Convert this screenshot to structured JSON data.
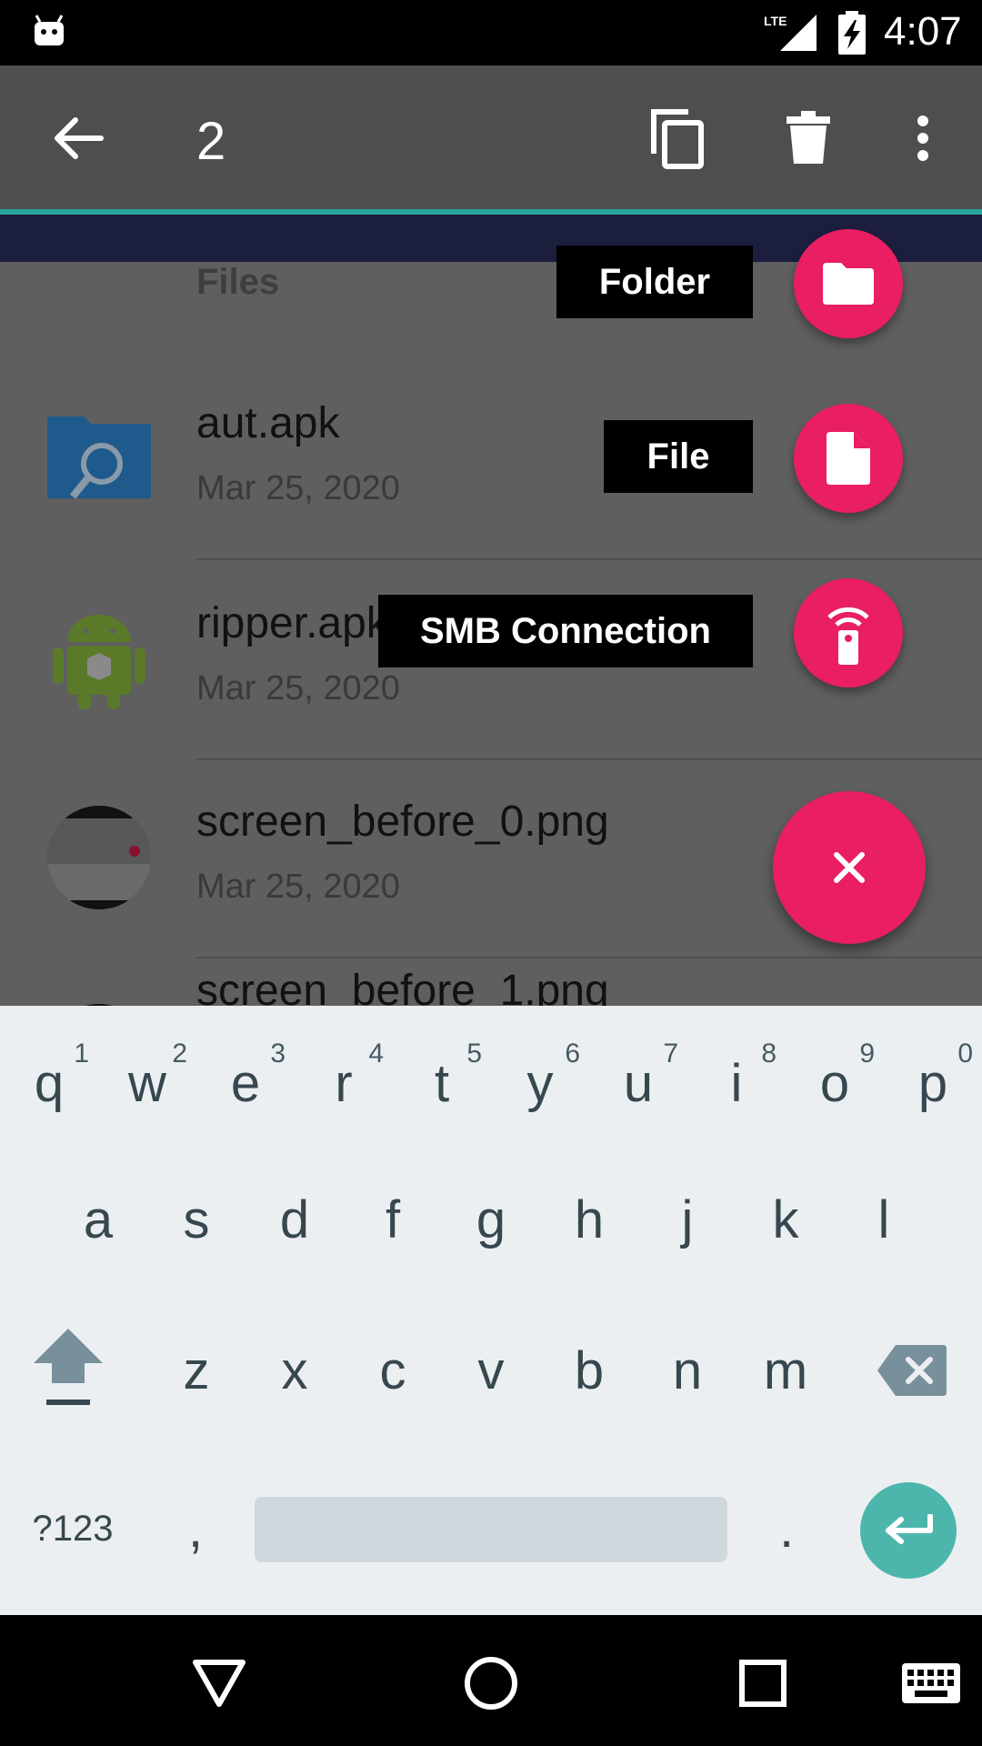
{
  "status_bar": {
    "network": "LTE",
    "time": "4:07",
    "icons": [
      "android-debug-icon",
      "lte-signal-icon",
      "battery-charging-icon"
    ]
  },
  "action_bar": {
    "selection_count": "2",
    "icons": [
      "back-arrow-icon",
      "copy-icon",
      "delete-icon",
      "more-vert-icon"
    ],
    "accent_color": "#26a69a"
  },
  "file_list": {
    "section_header": "Files",
    "items": [
      {
        "name": "aut.apk",
        "date": "Mar 25, 2020",
        "icon": "folder-search-icon"
      },
      {
        "name": "ripper.apk",
        "date": "Mar 25, 2020",
        "icon": "android-apk-icon"
      },
      {
        "name": "screen_before_0.png",
        "date": "Mar 25, 2020",
        "icon": "image-thumbnail"
      },
      {
        "name": "screen_before_1.png",
        "date": "",
        "icon": "image-thumbnail"
      }
    ]
  },
  "fab_menu": {
    "accent_color": "#e91e63",
    "items": [
      {
        "label": "Folder",
        "icon": "folder-icon"
      },
      {
        "label": "File",
        "icon": "file-icon"
      },
      {
        "label": "SMB Connection",
        "icon": "smb-remote-icon"
      }
    ],
    "close_icon": "close-icon"
  },
  "keyboard": {
    "row1": [
      {
        "key": "q",
        "hint": "1"
      },
      {
        "key": "w",
        "hint": "2"
      },
      {
        "key": "e",
        "hint": "3"
      },
      {
        "key": "r",
        "hint": "4"
      },
      {
        "key": "t",
        "hint": "5"
      },
      {
        "key": "y",
        "hint": "6"
      },
      {
        "key": "u",
        "hint": "7"
      },
      {
        "key": "i",
        "hint": "8"
      },
      {
        "key": "o",
        "hint": "9"
      },
      {
        "key": "p",
        "hint": "0"
      }
    ],
    "row2": [
      "a",
      "s",
      "d",
      "f",
      "g",
      "h",
      "j",
      "k",
      "l"
    ],
    "row3": [
      "z",
      "x",
      "c",
      "v",
      "b",
      "n",
      "m"
    ],
    "symbols_label": "?123",
    "comma": ",",
    "period": ".",
    "icons": [
      "shift-icon",
      "backspace-icon",
      "enter-icon"
    ],
    "enter_color": "#4db6ac"
  },
  "nav_bar": {
    "icons": [
      "back-triangle-icon",
      "home-circle-icon",
      "recents-square-icon",
      "keyboard-icon"
    ]
  }
}
